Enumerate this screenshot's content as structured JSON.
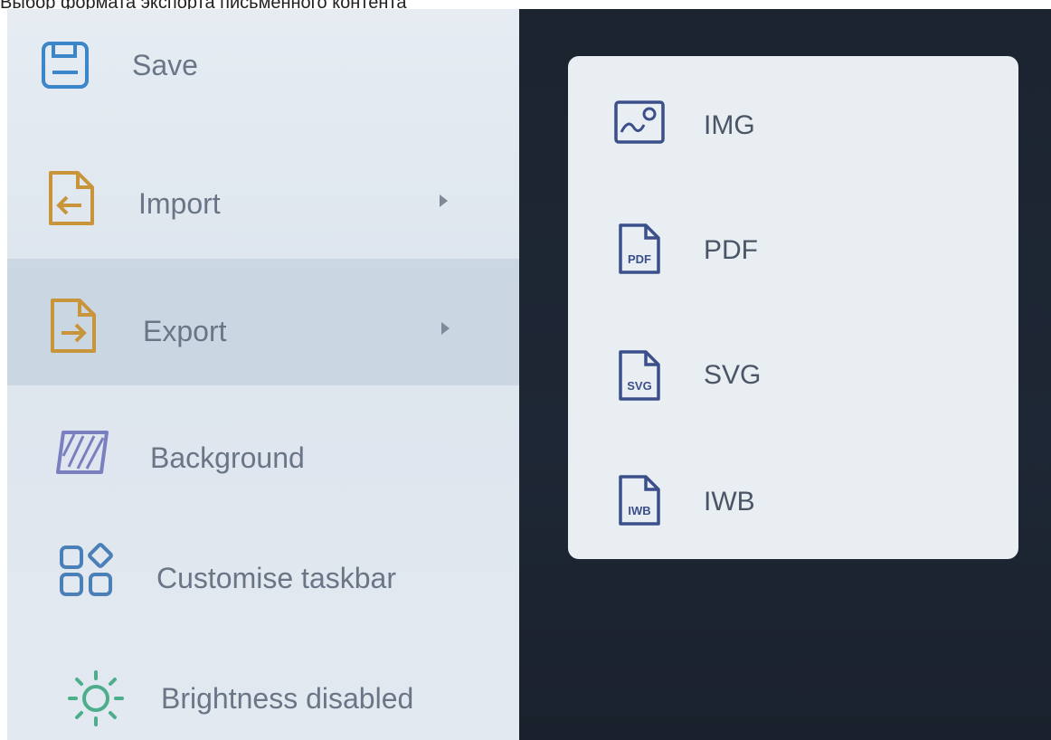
{
  "caption": "Выбор формата экспорта письменного контента",
  "menu": {
    "items": [
      {
        "label": "Save",
        "icon": "save-icon",
        "color": "#3a86c8"
      },
      {
        "label": "Import",
        "icon": "import-icon",
        "color": "#c9953a",
        "has_submenu": true
      },
      {
        "label": "Export",
        "icon": "export-icon",
        "color": "#c9953a",
        "has_submenu": true,
        "active": true
      },
      {
        "label": "Background",
        "icon": "background-icon",
        "color": "#7a7fc0"
      },
      {
        "label": "Customise taskbar",
        "icon": "taskbar-icon",
        "color": "#4a7fb8"
      },
      {
        "label": "Brightness disabled",
        "icon": "brightness-icon",
        "color": "#4cae8a"
      }
    ]
  },
  "export_menu": {
    "formats": [
      {
        "label": "IMG",
        "icon": "image-file-icon",
        "tag": ""
      },
      {
        "label": "PDF",
        "icon": "pdf-file-icon",
        "tag": "PDF"
      },
      {
        "label": "SVG",
        "icon": "svg-file-icon",
        "tag": "SVG"
      },
      {
        "label": "IWB",
        "icon": "iwb-file-icon",
        "tag": "IWB"
      }
    ],
    "icon_color": "#3b4f8a"
  }
}
